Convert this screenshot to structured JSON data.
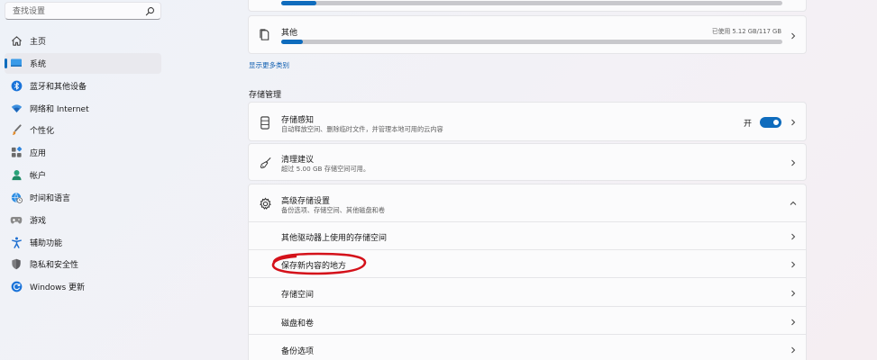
{
  "sidebar": {
    "search_placeholder": "查找设置",
    "items": [
      {
        "label": "主页",
        "icon": "home-icon"
      },
      {
        "label": "系统",
        "icon": "system-icon",
        "active": true
      },
      {
        "label": "蓝牙和其他设备",
        "icon": "bluetooth-icon"
      },
      {
        "label": "网络和 Internet",
        "icon": "wifi-icon"
      },
      {
        "label": "个性化",
        "icon": "brush-icon"
      },
      {
        "label": "应用",
        "icon": "apps-icon"
      },
      {
        "label": "帐户",
        "icon": "person-icon"
      },
      {
        "label": "时间和语言",
        "icon": "globe-clock-icon"
      },
      {
        "label": "游戏",
        "icon": "gamepad-icon"
      },
      {
        "label": "辅助功能",
        "icon": "accessibility-icon"
      },
      {
        "label": "隐私和安全性",
        "icon": "shield-icon"
      },
      {
        "label": "Windows 更新",
        "icon": "update-icon"
      }
    ]
  },
  "storage": {
    "top_bar_fill": 0.07,
    "other": {
      "title": "其他",
      "usage": "已使用 5.12 GB/117 GB",
      "fill": 0.044
    }
  },
  "more_categories_link": "显示更多类别",
  "management": {
    "section_title": "存储管理",
    "sense": {
      "title": "存储感知",
      "subtitle": "自动释放空间、删除临时文件，并管理本地可用的云内容",
      "toggle_label": "开",
      "toggle_on": true
    },
    "cleanup": {
      "title": "清理建议",
      "subtitle": "超过 5.00 GB 存储空间可用。"
    },
    "advanced": {
      "title": "高级存储设置",
      "subtitle": "备份选项、存储空间、其他磁盘和卷",
      "items": [
        "其他驱动器上使用的存储空间",
        "保存新内容的地方",
        "存储空间",
        "磁盘和卷",
        "备份选项"
      ]
    }
  },
  "colors": {
    "accent": "#0f6cbd",
    "highlight_ellipse": "#d4111a"
  }
}
